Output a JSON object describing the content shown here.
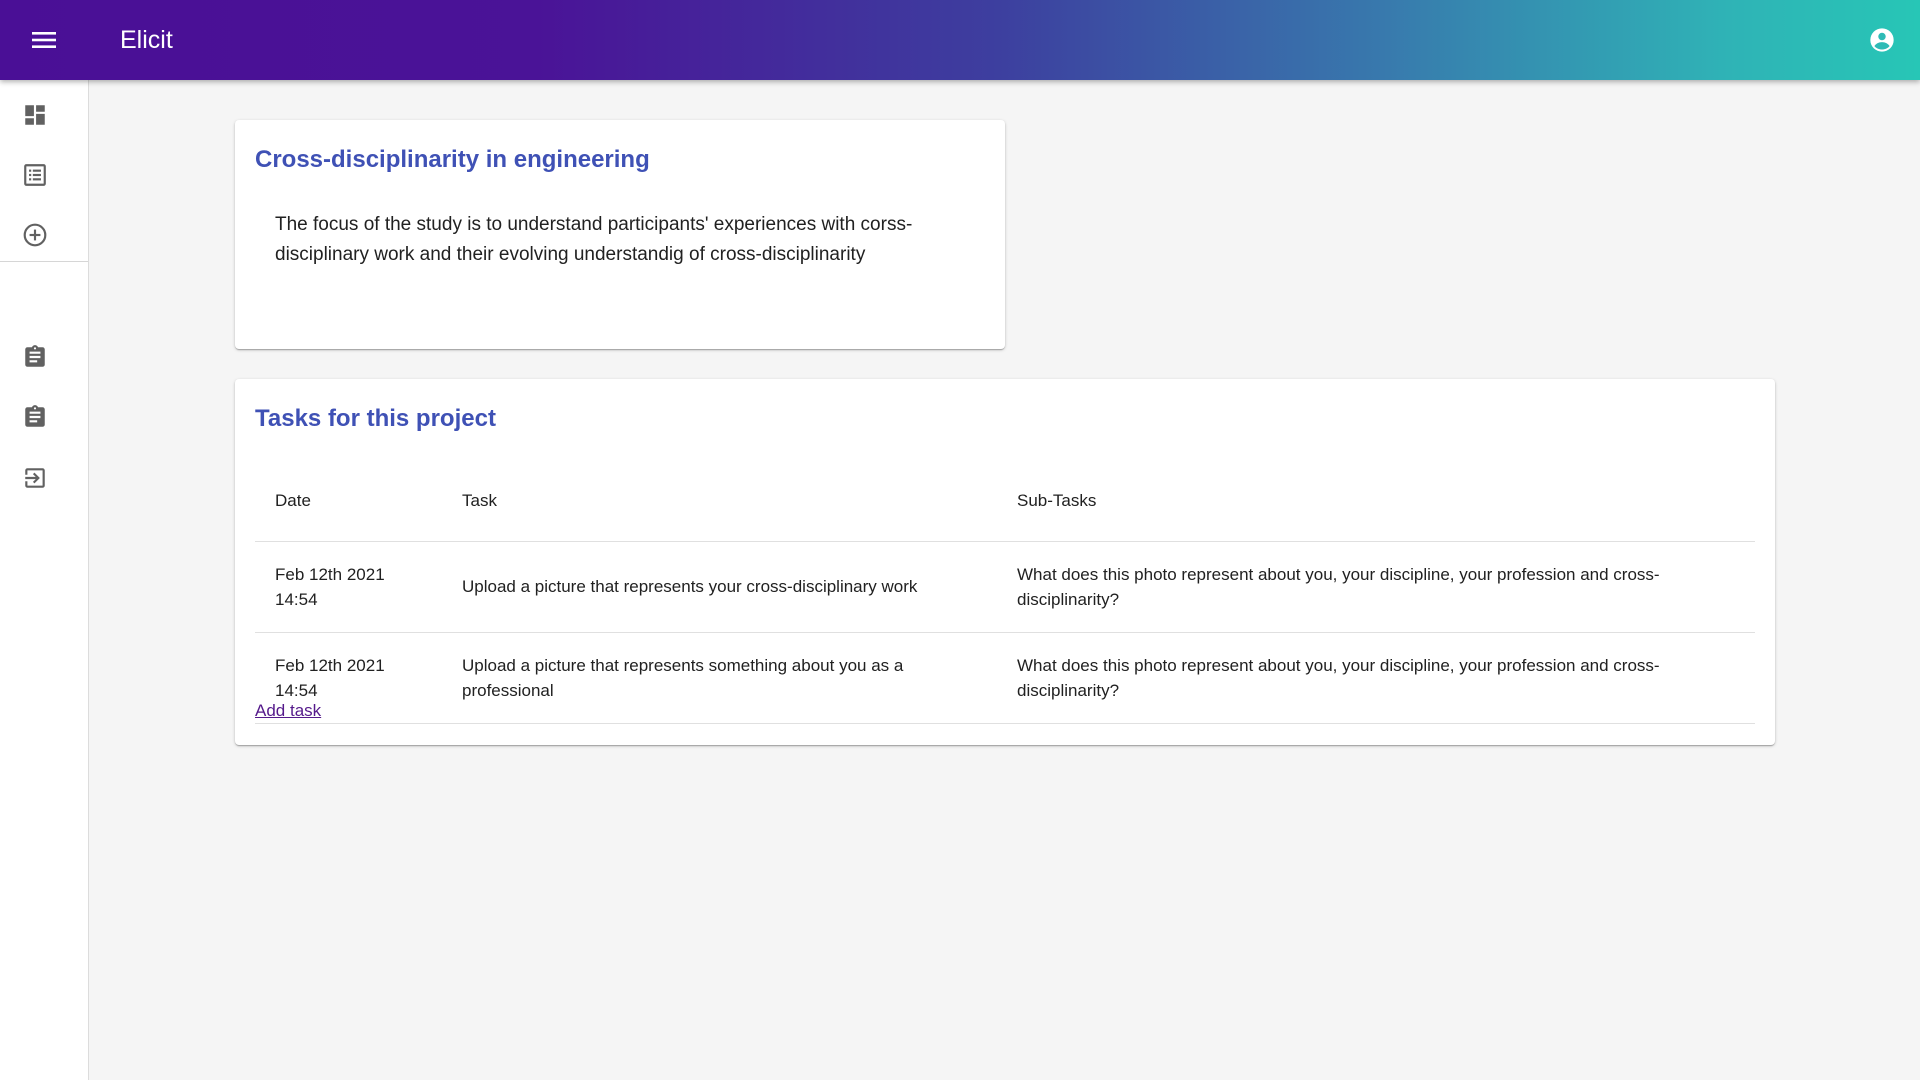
{
  "app": {
    "title": "Elicit"
  },
  "icons": {
    "menu": "menu-icon",
    "account": "account-circle-icon",
    "dashboard": "dashboard-icon",
    "list": "list-icon",
    "add": "add-circle-icon",
    "assignment1": "clipboard-icon",
    "assignment2": "clipboard-icon",
    "exit": "exit-icon"
  },
  "colors": {
    "appbar_start": "#4a0f96",
    "appbar_end": "#27c6b6",
    "card_title": "#3f51b5",
    "link": "#551a8b"
  },
  "project": {
    "title": "Cross-disciplinarity in engineering",
    "description": "The focus of the study is to understand participants' experiences with corss-disciplinary work and their evolving understandig of cross-disciplinarity"
  },
  "tasks": {
    "title": "Tasks for this project",
    "headers": {
      "date": "Date",
      "task": "Task",
      "subtasks": "Sub-Tasks"
    },
    "rows": [
      {
        "date": "Feb 12th 2021 14:54",
        "task": "Upload a picture that represents your cross-disciplinary work",
        "subtasks": "What does this photo represent about you, your discipline, your profession and cross-disciplinarity?"
      },
      {
        "date": "Feb 12th 2021 14:54",
        "task": "Upload a picture that represents something about you as a professional",
        "subtasks": "What does this photo represent about you, your discipline, your profession and cross-disciplinarity?"
      }
    ],
    "add_label": "Add task"
  }
}
